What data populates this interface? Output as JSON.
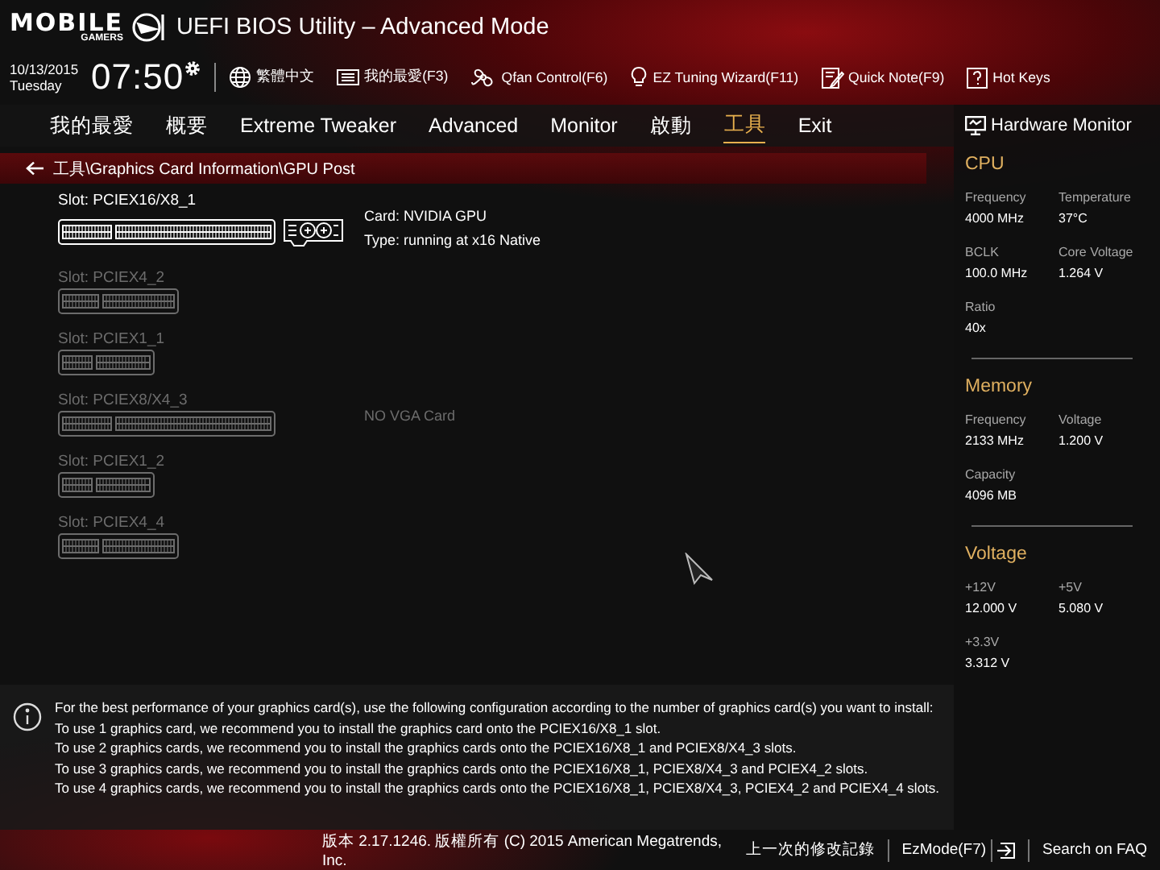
{
  "header": {
    "logo": {
      "wordmark": "MOBILE",
      "subtitle": "GAMERS"
    },
    "title": "UEFI BIOS Utility – Advanced Mode",
    "date": "10/13/2015",
    "weekday": "Tuesday",
    "time": "07:50",
    "tools": [
      {
        "label": "繁體中文"
      },
      {
        "label": "我的最愛(F3)"
      },
      {
        "label": "Qfan Control(F6)"
      },
      {
        "label": "EZ Tuning Wizard(F11)"
      },
      {
        "label": "Quick Note(F9)"
      },
      {
        "label": "Hot Keys"
      }
    ]
  },
  "tabs": [
    {
      "label": "我的最愛",
      "selected": false
    },
    {
      "label": "概要",
      "selected": false
    },
    {
      "label": "Extreme Tweaker",
      "selected": false
    },
    {
      "label": "Advanced",
      "selected": false
    },
    {
      "label": "Monitor",
      "selected": false
    },
    {
      "label": "啟動",
      "selected": false
    },
    {
      "label": "工具",
      "selected": true
    },
    {
      "label": "Exit",
      "selected": false
    }
  ],
  "breadcrumb": "工具\\Graphics Card Information\\GPU Post",
  "slots": [
    {
      "label": "Slot: PCIEX16/X8_1",
      "kind": "x16",
      "occupied": true,
      "info": [
        "Card: NVIDIA GPU",
        "Type: running at x16 Native"
      ]
    },
    {
      "label": "Slot: PCIEX4_2",
      "kind": "x4",
      "occupied": false
    },
    {
      "label": "Slot: PCIEX1_1",
      "kind": "x1",
      "occupied": false
    },
    {
      "label": "Slot: PCIEX8/X4_3",
      "kind": "x16",
      "occupied": false,
      "info": [
        "NO VGA Card"
      ]
    },
    {
      "label": "Slot: PCIEX1_2",
      "kind": "x1",
      "occupied": false
    },
    {
      "label": "Slot: PCIEX4_4",
      "kind": "x4",
      "occupied": false
    }
  ],
  "hardware_monitor": {
    "title": "Hardware Monitor",
    "sections": [
      {
        "title": "CPU",
        "items": [
          {
            "label": "Frequency",
            "value": "4000 MHz"
          },
          {
            "label": "Temperature",
            "value": "37°C"
          },
          {
            "label": "BCLK",
            "value": "100.0 MHz"
          },
          {
            "label": "Core Voltage",
            "value": "1.264 V"
          },
          {
            "label": "Ratio",
            "value": "40x"
          }
        ]
      },
      {
        "title": "Memory",
        "items": [
          {
            "label": "Frequency",
            "value": "2133 MHz"
          },
          {
            "label": "Voltage",
            "value": "1.200 V"
          },
          {
            "label": "Capacity",
            "value": "4096 MB"
          }
        ]
      },
      {
        "title": "Voltage",
        "items": [
          {
            "label": "+12V",
            "value": "12.000 V"
          },
          {
            "label": "+5V",
            "value": "5.080 V"
          },
          {
            "label": "+3.3V",
            "value": "3.312 V"
          }
        ]
      }
    ]
  },
  "info": [
    "For the best performance of your graphics card(s), use the following configuration according to the number of graphics card(s) you want to install:",
    "To use 1 graphics card, we recommend you to install  the graphics card onto the PCIEX16/X8_1 slot.",
    "To use 2 graphics cards, we recommend you to install the graphics cards onto the PCIEX16/X8_1 and PCIEX8/X4_3 slots.",
    "To use 3 graphics cards, we recommend you to install the graphics cards onto the PCIEX16/X8_1, PCIEX8/X4_3 and PCIEX4_2 slots.",
    "To use 4 graphics cards, we recommend you to install the graphics cards onto the PCIEX16/X8_1, PCIEX8/X4_3, PCIEX4_2 and PCIEX4_4 slots."
  ],
  "footer": {
    "buttons": [
      {
        "label": "上一次的修改記錄"
      },
      {
        "label": "EzMode(F7)"
      },
      {
        "label": "Search on FAQ"
      }
    ],
    "version": "版本 2.17.1246. 版權所有 (C) 2015 American Megatrends, Inc."
  }
}
